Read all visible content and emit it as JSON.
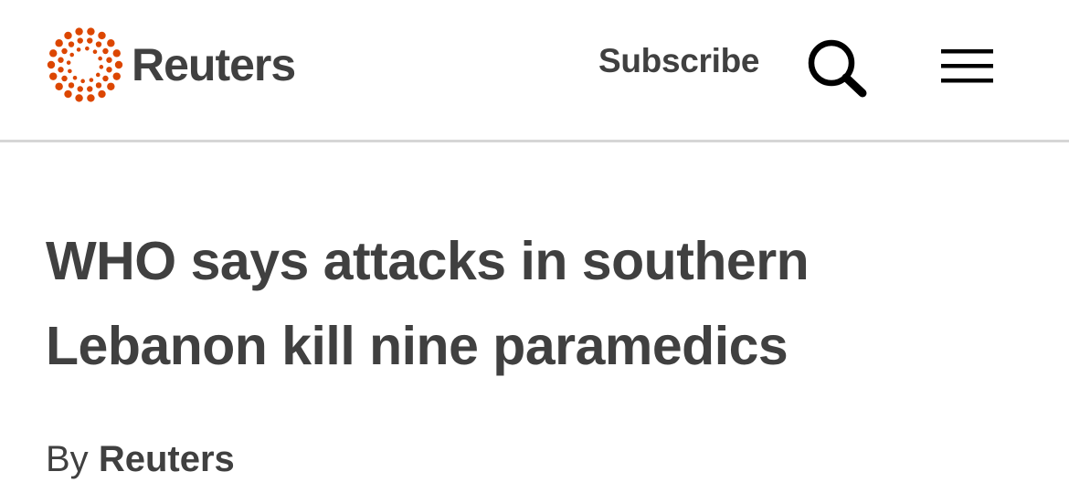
{
  "header": {
    "brand": "Reuters",
    "logo_icon": "reuters-dot-ring-icon",
    "subscribe_label": "Subscribe",
    "search_icon": "search-icon",
    "menu_icon": "hamburger-menu-icon"
  },
  "article": {
    "headline": "WHO says attacks in southern Lebanon kill nine paramedics",
    "byline_prefix": "By",
    "byline_author": "Reuters"
  },
  "colors": {
    "brand_orange": "#dc4600",
    "text": "#404040",
    "divider": "#d6d6d6",
    "background": "#ffffff"
  }
}
